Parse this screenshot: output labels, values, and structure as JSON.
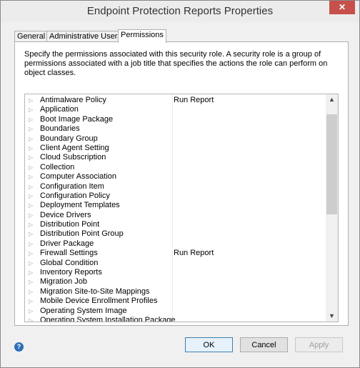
{
  "window": {
    "title": "Endpoint Protection Reports Properties",
    "close_symbol": "✕"
  },
  "tabs": [
    {
      "label": "General",
      "active": false
    },
    {
      "label": "Administrative Users",
      "active": false
    },
    {
      "label": "Permissions",
      "active": true
    }
  ],
  "description": "Specify the permissions associated with this security role. A security role is a group of permissions associated with a job title that specifies the actions the role can perform on object classes.",
  "permissions": [
    {
      "name": "Antimalware Policy",
      "permission": "Run Report"
    },
    {
      "name": "Application",
      "permission": ""
    },
    {
      "name": "Boot Image Package",
      "permission": ""
    },
    {
      "name": "Boundaries",
      "permission": ""
    },
    {
      "name": "Boundary Group",
      "permission": ""
    },
    {
      "name": "Client Agent Setting",
      "permission": ""
    },
    {
      "name": "Cloud Subscription",
      "permission": ""
    },
    {
      "name": "Collection",
      "permission": ""
    },
    {
      "name": "Computer Association",
      "permission": ""
    },
    {
      "name": "Configuration Item",
      "permission": ""
    },
    {
      "name": "Configuration Policy",
      "permission": ""
    },
    {
      "name": "Deployment Templates",
      "permission": ""
    },
    {
      "name": "Device Drivers",
      "permission": ""
    },
    {
      "name": "Distribution Point",
      "permission": ""
    },
    {
      "name": "Distribution Point Group",
      "permission": ""
    },
    {
      "name": "Driver Package",
      "permission": ""
    },
    {
      "name": "Firewall Settings",
      "permission": "Run Report"
    },
    {
      "name": "Global Condition",
      "permission": ""
    },
    {
      "name": "Inventory Reports",
      "permission": ""
    },
    {
      "name": "Migration Job",
      "permission": ""
    },
    {
      "name": "Migration Site-to-Site Mappings",
      "permission": ""
    },
    {
      "name": "Mobile Device Enrollment Profiles",
      "permission": ""
    },
    {
      "name": "Operating System Image",
      "permission": ""
    },
    {
      "name": "Operating System Installation Package",
      "permission": ""
    }
  ],
  "expander_symbol": "▷",
  "scrollbar": {
    "up_symbol": "▲",
    "down_symbol": "▼"
  },
  "footer": {
    "help_symbol": "?",
    "ok_label": "OK",
    "cancel_label": "Cancel",
    "apply_label": "Apply"
  }
}
